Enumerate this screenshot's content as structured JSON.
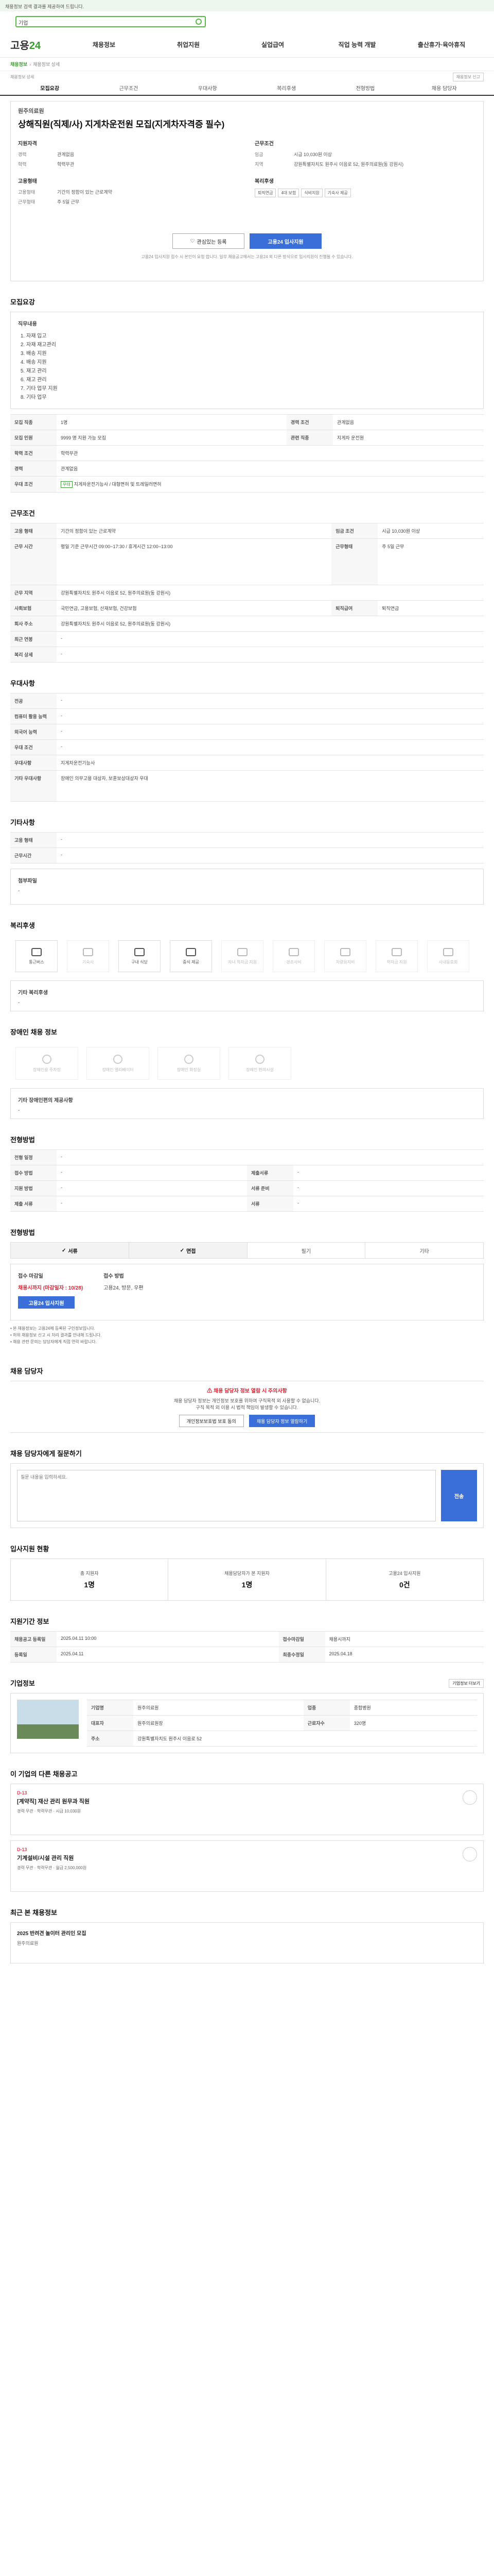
{
  "notice": "채용정보 검색 결과를 제공하여 드립니다.",
  "search": {
    "tag": "기업",
    "placeholder": ""
  },
  "logo": {
    "a": "고용",
    "b": "24"
  },
  "gnb": [
    "채용정보",
    "취업지원",
    "실업급여",
    "직업 능력 개발",
    "출산휴가·육아휴직"
  ],
  "subnav": {
    "home": "채용정보",
    "path": "채용정보 상세"
  },
  "page": {
    "title": "채용정보 상세",
    "report": "채용정보 신고"
  },
  "tabs": [
    "모집요강",
    "근무조건",
    "우대사항",
    "복리후생",
    "전형방법",
    "채용 담당자"
  ],
  "summary": {
    "company": "원주의료원",
    "title": "상해직원(직제/사) 지게차운전원 모집(지게차자격증 필수)",
    "left_label": "지원자격",
    "left": [
      [
        "경력",
        "관계없음"
      ],
      [
        "학력",
        "학력무관"
      ]
    ],
    "right_label": "근무조건",
    "right": [
      [
        "임금",
        "시급 10,030원 이상"
      ],
      [
        "지역",
        "강원특별자치도 원주시 이음로 52, 원주의료원(동 강원시)"
      ]
    ],
    "cond_label": "고용형태",
    "cond": [
      [
        "고용형태",
        "기간의 정함이 있는 근로계약"
      ],
      [
        "근무형태",
        "주 5일 근무"
      ]
    ],
    "welfare_label": "복리후생",
    "welfare": [
      "퇴직연금",
      "4대 보험",
      "식비지원",
      "기숙사 제공"
    ],
    "scrap": "관심있는 등록",
    "apply": "고용24 입사지원",
    "note": "고용24 입사지원 접수 시 본인이 요청 합니다. 일부 채용공고에서는 고용24 외 다른 방식으로 입사지원이 진행될 수 있습니다."
  },
  "recruit": {
    "heading": "모집요강",
    "duty_label": "직무내용",
    "duties": [
      "자재 입고",
      "자재 재고관리",
      "배송 지원",
      "배송 지원",
      "재고 관리",
      "재고 관리",
      "기타 업무 지원",
      "기타 업무"
    ],
    "rows": [
      [
        "모집 직종",
        "1명",
        "경력 조건",
        "관계없음"
      ],
      [
        "모집 인원",
        "9999 명 지원 가능 모집",
        "관련 직종",
        "지게차 운전원"
      ],
      [
        "학력 조건",
        "학력무관",
        "",
        ""
      ],
      [
        "경력",
        "관계없음",
        "",
        ""
      ],
      [
        "우대 조건",
        "지게차운전기능사 / 대형면허 및 트레일러면허",
        "",
        ""
      ]
    ]
  },
  "work": {
    "heading": "근무조건",
    "rows": [
      [
        "고용 형태",
        "기간의 정함이 있는 근로계약",
        "임금 조건",
        "시급 10,030원 이상"
      ],
      [
        "근무 시간",
        "평일 기준 근무시간 09:00~17:30 / 휴게시간 12:00~13:00",
        "근무형태",
        "주 5일 근무"
      ],
      [
        "근무 지역",
        "강원특별자치도 원주시 이음로 52, 원주의료원(동 강원시)",
        "",
        ""
      ],
      [
        "사회보험",
        "국민연금, 고용보험, 산재보험, 건강보험",
        "퇴직급여",
        "퇴직연금"
      ],
      [
        "회사 주소",
        "강원특별자치도 원주시 이음로 52, 원주의료원(동 강원시)",
        "",
        ""
      ],
      [
        "최근 연봉",
        "-",
        "",
        ""
      ],
      [
        "복리 상세",
        "-",
        "",
        ""
      ]
    ]
  },
  "pref": {
    "heading": "우대사항",
    "rows": [
      [
        "전공",
        "-"
      ],
      [
        "컴퓨터 활용 능력",
        "-"
      ],
      [
        "외국어 능력",
        "-"
      ],
      [
        "우대 조건",
        "-"
      ],
      [
        "우대사항",
        "지게차운전기능사"
      ],
      [
        "기타 우대사항",
        "장애인 의무고용 대상자, 보훈보상대상자 우대"
      ]
    ]
  },
  "other": {
    "heading": "기타사항",
    "rows": [
      [
        "고용 형태",
        "-"
      ],
      [
        "근무시간",
        "-"
      ],
      [
        "첨부파일",
        "-"
      ]
    ]
  },
  "benefit": {
    "heading": "복리후생",
    "items": [
      {
        "label": "통근버스",
        "on": true
      },
      {
        "label": "기숙사",
        "on": false
      },
      {
        "label": "구내 식당",
        "on": true
      },
      {
        "label": "중식 제공",
        "on": true
      },
      {
        "label": "자녀 학자금 지원",
        "on": false
      },
      {
        "label": "경조사비",
        "on": false
      },
      {
        "label": "차량유지비",
        "on": false
      },
      {
        "label": "학자금 지원",
        "on": false
      },
      {
        "label": "사내동호회",
        "on": false
      }
    ],
    "etc_label": "기타 복리후생",
    "etc": "-"
  },
  "disability": {
    "heading": "장애인 채용 정보",
    "items": [
      "장애인용 주차장",
      "장애인 엘리베이터",
      "장애인 화장실",
      "장애인 편의시설"
    ],
    "etc_label": "기타 장애인편의 제공사항",
    "etc": "-"
  },
  "screening": {
    "heading": "전형방법",
    "rows": [
      [
        "전형 일정",
        "-",
        "",
        ""
      ],
      [
        "접수 방법",
        "-",
        "제출서류",
        "-"
      ],
      [
        "지원 방법",
        "-",
        "서류 준비",
        "-"
      ],
      [
        "제출 서류",
        "-",
        "서류",
        "-"
      ]
    ]
  },
  "apply_method": {
    "heading": "전형방법",
    "methods": [
      "서류",
      "면접",
      "필기",
      "기타"
    ],
    "apply_label": "접수 마감일",
    "apply_value": "채용시까지 (마감일자 : 10/28)",
    "process_label": "접수 방법",
    "process_value": "고용24, 방문, 우편",
    "btn": "고용24 입사지원",
    "bullets": [
      "본 채용정보는 고용24에 등록된 구인정보입니다.",
      "허위 채용정보 신고 시 처리 결과를 안내해 드립니다.",
      "채용 관련 문의는 담당자에게 직접 연락 바랍니다."
    ]
  },
  "contact": {
    "heading": "채용 담당자",
    "warn": "채용 담당자 정보 열람 시 주의사항",
    "line1": "채용 담당자 정보는 개인정보 보호를 위하여 구직목적 외 사용할 수 없습니다.",
    "line2": "구직 목적 외 이용 시 법적 책임이 발생할 수 있습니다.",
    "btn_a": "개인정보보호법 보호 동의",
    "btn_b": "채용 담당자 정보 열람하기"
  },
  "qa": {
    "heading": "채용 담당자에게 질문하기",
    "placeholder": "질문 내용을 입력하세요.",
    "send": "전송"
  },
  "stats": {
    "heading": "입사지원 현황",
    "items": [
      [
        "총 지원자",
        "1명"
      ],
      [
        "채용담당자가 본 지원자",
        "1명"
      ],
      [
        "고용24 입사지원",
        "0건"
      ]
    ]
  },
  "dates": {
    "heading": "지원기간 정보",
    "rows": [
      [
        "채용공고 등록일",
        "2025.04.11 10:00",
        "접수마감일",
        "채용시까지"
      ],
      [
        "등록일",
        "2025.04.11",
        "최종수정일",
        "2025.04.18"
      ]
    ]
  },
  "company": {
    "heading": "기업정보",
    "rows": [
      [
        "기업명",
        "원주의료원",
        "업종",
        "종합병원"
      ],
      [
        "대표자",
        "원주의료원장",
        "근로자수",
        "320명"
      ],
      [
        "주소",
        "강원특별자치도 원주시 이음로 52",
        "",
        ""
      ]
    ],
    "more": "기업정보 더보기"
  },
  "other_jobs": {
    "heading": "이 기업의 다른 채용공고",
    "jobs": [
      {
        "dday": "D-13",
        "title": "[계약직] 재산 관리 원무과 직원",
        "meta": "경력 무관 · 학력무관 · 시급 10,030원"
      },
      {
        "dday": "D-13",
        "title": "기계설비/시설 관리 직원",
        "meta": "경력 무관 · 학력무관 · 월급 2,500,000원"
      }
    ]
  },
  "recent": {
    "heading": "최근 본 채용정보",
    "title": "2025 반려견 놀이터 관리인 모집",
    "company": "원주의료원"
  }
}
